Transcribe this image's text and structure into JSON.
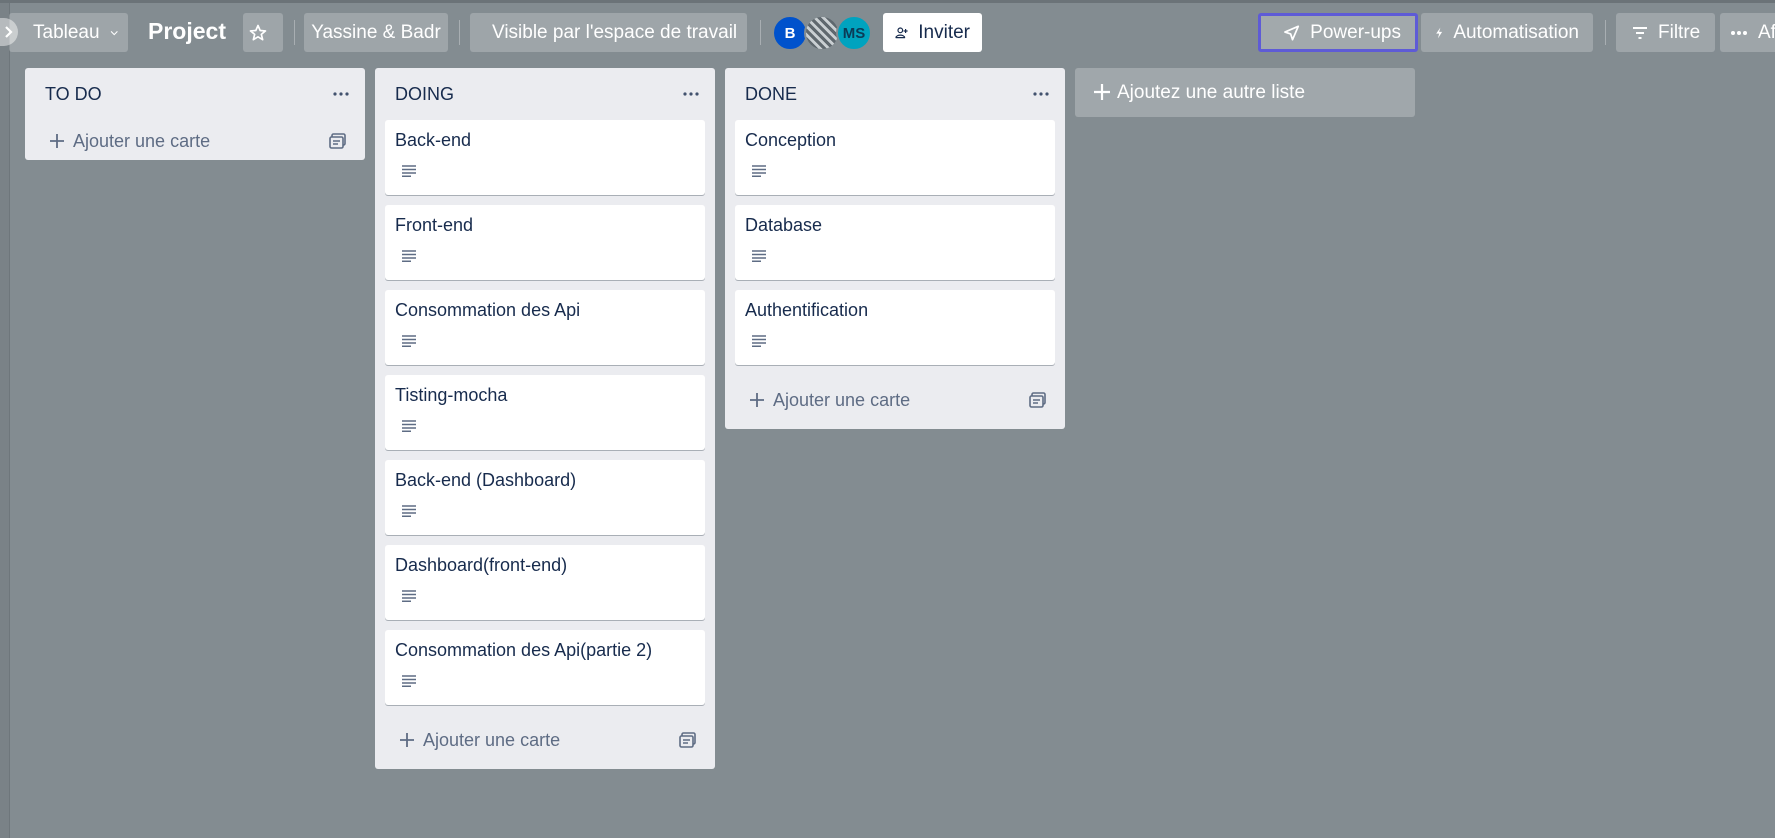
{
  "header": {
    "view_switcher": "Tableau",
    "board_title": "Project",
    "workspace": "Yassine & Badr",
    "visibility": "Visible par l'espace de travail",
    "members": [
      {
        "initials": "B",
        "color": "#0052cc"
      },
      {
        "initials": "",
        "color": "#9aa3a8"
      },
      {
        "initials": "MS",
        "color": "#00a3bf"
      }
    ],
    "invite_label": "Inviter",
    "powerups_label": "Power-ups",
    "automation_label": "Automatisation",
    "filter_label": "Filtre",
    "overflow_label": "Af"
  },
  "lists": [
    {
      "title": "TO DO",
      "cards": [],
      "add_card_label": "Ajouter une carte"
    },
    {
      "title": "DOING",
      "cards": [
        "Back-end",
        "Front-end",
        "Consommation des Api",
        "Tisting-mocha",
        "Back-end (Dashboard)",
        "Dashboard(front-end)",
        "Consommation des Api(partie 2)"
      ],
      "add_card_label": "Ajouter une carte"
    },
    {
      "title": "DONE",
      "cards": [
        "Conception",
        "Database",
        "Authentification"
      ],
      "add_card_label": "Ajouter une carte"
    }
  ],
  "add_list_label": "Ajoutez une autre liste",
  "colors": {
    "board_background": "#838c91",
    "list_background": "#ebecf0",
    "powerups_border": "#5e5bd6"
  }
}
